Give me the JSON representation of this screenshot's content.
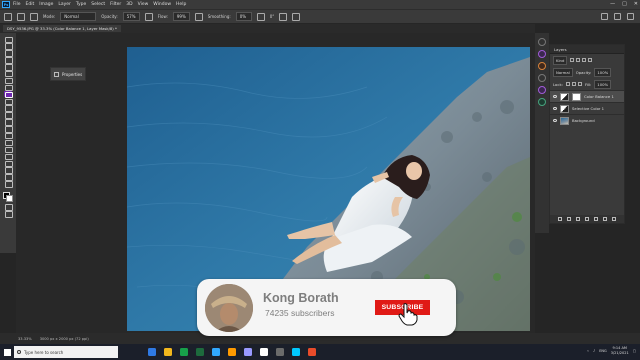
{
  "menubar": {
    "app_logo": "Ps",
    "items": [
      "File",
      "Edit",
      "Image",
      "Layer",
      "Type",
      "Select",
      "Filter",
      "3D",
      "View",
      "Window",
      "Help"
    ],
    "window_controls": [
      "—",
      "□",
      "✕"
    ]
  },
  "options": {
    "mode_label": "Mode:",
    "mode_value": "Normal",
    "opacity_label": "Opacity:",
    "opacity_value": "57%",
    "flow_label": "Flow:",
    "flow_value": "99%",
    "smoothing_label": "Smoothing:",
    "smoothing_value": "0%",
    "angle_value": "0°"
  },
  "document": {
    "tab_title": "DSY_9536.JPG @ 33.3% (Color Balance 1, Layer Mask/8) *"
  },
  "properties_panel": {
    "title": "Properties"
  },
  "layers_panel": {
    "title": "Layers",
    "filter_kind": "Kind",
    "blend_mode": "Normal",
    "opacity_label": "Opacity:",
    "opacity_value": "100%",
    "lock_label": "Lock:",
    "fill_label": "Fill:",
    "fill_value": "100%",
    "layers": [
      {
        "name": "Color Balance 1",
        "type": "adjustment",
        "active": true
      },
      {
        "name": "Selective Color 1",
        "type": "adjustment",
        "active": false
      },
      {
        "name": "Background",
        "type": "image",
        "active": false
      }
    ]
  },
  "status": {
    "zoom": "33.33%",
    "doc_size": "3000 px x 2000 px (72 ppi)"
  },
  "subscribe_overlay": {
    "channel_name": "Kong Borath",
    "subscribers": "74235 subscribers",
    "button_label": "SUBSCRIBE"
  },
  "taskbar": {
    "search_placeholder": "Type here to search",
    "time": "9:14 AM",
    "date": "3/21/2021",
    "language": "ENG",
    "app_colors": [
      "#2f7ae5",
      "#f2b71d",
      "#17a04a",
      "#1d6a3d",
      "#31a8ff",
      "#ff9a00",
      "#9999ff",
      "#ffffff",
      "#6b6b6b",
      "#00c8ff",
      "#ea4c2a"
    ]
  }
}
